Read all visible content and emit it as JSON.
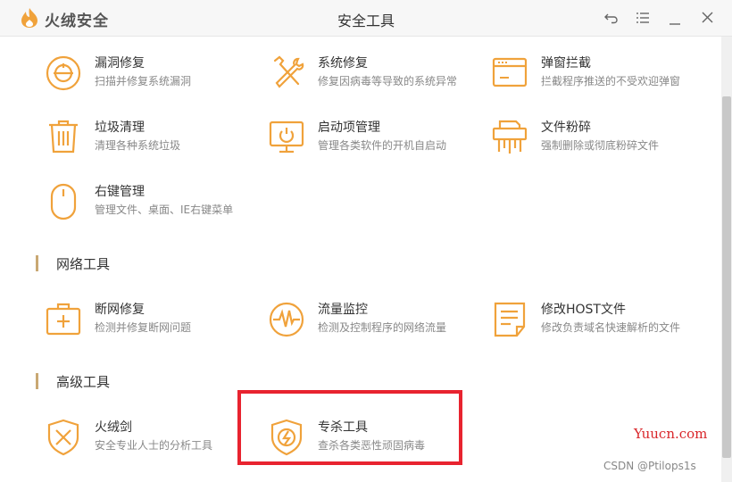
{
  "window": {
    "brand": "火绒安全",
    "title": "安全工具",
    "colors": {
      "accent": "#f0a23b",
      "highlight": "#e8232f",
      "section_bar": "#c9a873"
    }
  },
  "controls": {
    "back_icon": "back-arrow-icon",
    "menu_icon": "menu-icon",
    "minimize_icon": "minimize-icon",
    "close_icon": "close-icon"
  },
  "system_tools": [
    {
      "title": "漏洞修复",
      "desc": "扫描并修复系统漏洞",
      "icon": "vulnerability-icon"
    },
    {
      "title": "系统修复",
      "desc": "修复因病毒等导致的系统异常",
      "icon": "wrench-screwdriver-icon"
    },
    {
      "title": "弹窗拦截",
      "desc": "拦截程序推送的不受欢迎弹窗",
      "icon": "popup-window-icon"
    },
    {
      "title": "垃圾清理",
      "desc": "清理各种系统垃圾",
      "icon": "trash-icon"
    },
    {
      "title": "启动项管理",
      "desc": "管理各类软件的开机自启动",
      "icon": "monitor-power-icon"
    },
    {
      "title": "文件粉碎",
      "desc": "强制删除或彻底粉碎文件",
      "icon": "shredder-icon"
    },
    {
      "title": "右键管理",
      "desc": "管理文件、桌面、IE右键菜单",
      "icon": "mouse-icon"
    }
  ],
  "network_section": "网络工具",
  "network_tools": [
    {
      "title": "断网修复",
      "desc": "检测并修复断网问题",
      "icon": "medkit-icon"
    },
    {
      "title": "流量监控",
      "desc": "检测及控制程序的网络流量",
      "icon": "pulse-icon"
    },
    {
      "title": "修改HOST文件",
      "desc": "修改负责域名快速解析的文件",
      "icon": "document-icon"
    }
  ],
  "advanced_section": "高级工具",
  "advanced_tools": [
    {
      "title": "火绒剑",
      "desc": "安全专业人士的分析工具",
      "icon": "sword-shield-icon"
    },
    {
      "title": "专杀工具",
      "desc": "查杀各类恶性顽固病毒",
      "icon": "shield-bolt-icon"
    }
  ],
  "watermarks": {
    "site": "Yuucn.com",
    "author": "CSDN @Ptilops1s"
  }
}
